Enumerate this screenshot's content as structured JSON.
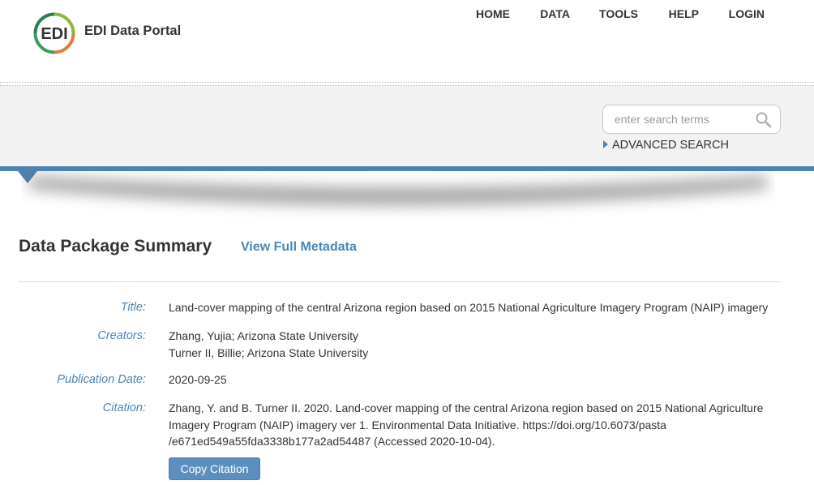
{
  "header": {
    "brand": "EDI Data Portal",
    "logo_icon": "edi-logo",
    "nav": [
      {
        "label": "HOME"
      },
      {
        "label": "DATA"
      },
      {
        "label": "TOOLS"
      },
      {
        "label": "HELP"
      },
      {
        "label": "LOGIN"
      }
    ]
  },
  "search": {
    "placeholder": "enter search terms",
    "value": "",
    "button_icon": "search-icon",
    "advanced_label": "ADVANCED SEARCH"
  },
  "summary": {
    "heading": "Data Package Summary",
    "full_metadata_link": "View Full Metadata",
    "title_label": "Title:",
    "title_value": "Land-cover mapping of the central Arizona region based on 2015 National Agriculture Imagery Program (NAIP) imagery",
    "creators_label": "Creators:",
    "creators": [
      "Zhang, Yujia; Arizona State University",
      "Turner II, Billie; Arizona State University"
    ],
    "pubdate_label": "Publication Date:",
    "pubdate_value": "2020-09-25",
    "citation_label": "Citation:",
    "citation_lines": [
      "Zhang, Y. and B. Turner II. 2020. Land-cover mapping of the central Arizona region based on 2015 National Agriculture",
      "Imagery Program (NAIP) imagery ver 1. Environmental Data Initiative. https://doi.org/10.6073/pasta",
      "/e671ed549a55fda3338b177a2ad54487 (Accessed 2020-10-04)."
    ],
    "copy_button": "Copy Citation"
  },
  "colors": {
    "accent": "#4a86b8",
    "band": "#f2f2f2",
    "rule": "#4f83af",
    "text": "#333333"
  }
}
